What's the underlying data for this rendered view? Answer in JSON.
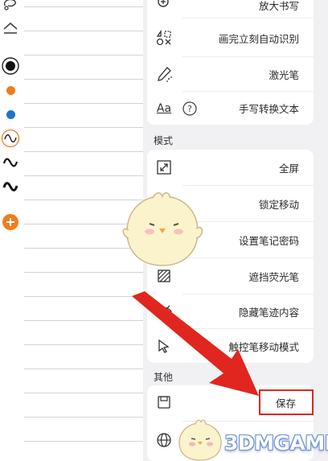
{
  "tool_rail": {
    "tools": [
      {
        "name": "lasso-icon"
      },
      {
        "name": "shape-icon"
      },
      {
        "name": "pen-color-black",
        "color": "#111111"
      },
      {
        "name": "pen-color-orange",
        "color": "#f07d1e"
      },
      {
        "name": "pen-color-blue",
        "color": "#1d74c9"
      },
      {
        "name": "stroke-style-thin-selected",
        "color": "#f07d1e"
      },
      {
        "name": "stroke-style-medium"
      },
      {
        "name": "stroke-style-thick"
      },
      {
        "name": "add-icon",
        "color": "#f07d1e"
      }
    ]
  },
  "menu": {
    "top_partial": {
      "label": "放大书写"
    },
    "recognize": {
      "label": "画完立刻自动识别"
    },
    "laser": {
      "label": "激光笔"
    },
    "handwriting": {
      "label": "手写转换文本",
      "icon_text": "Aa"
    },
    "mode_section": {
      "title": "模式"
    },
    "fullscreen": {
      "label": "全屏"
    },
    "lock_move": {
      "label": "锁定移动"
    },
    "password": {
      "label": "设置笔记密码"
    },
    "mask_highlighter": {
      "label": "遮挡荧光笔"
    },
    "hide_strokes": {
      "label": "隐藏笔迹内容"
    },
    "touch_mode": {
      "label": "触控笔移动模式"
    },
    "other_section": {
      "title": "其他"
    },
    "save": {
      "label": "保存"
    }
  },
  "watermark": {
    "text": "3DMGAME"
  },
  "colors": {
    "accent_orange": "#f07d1e",
    "arrow_red": "#e0261f",
    "panel_bg": "#f1f1f3"
  }
}
